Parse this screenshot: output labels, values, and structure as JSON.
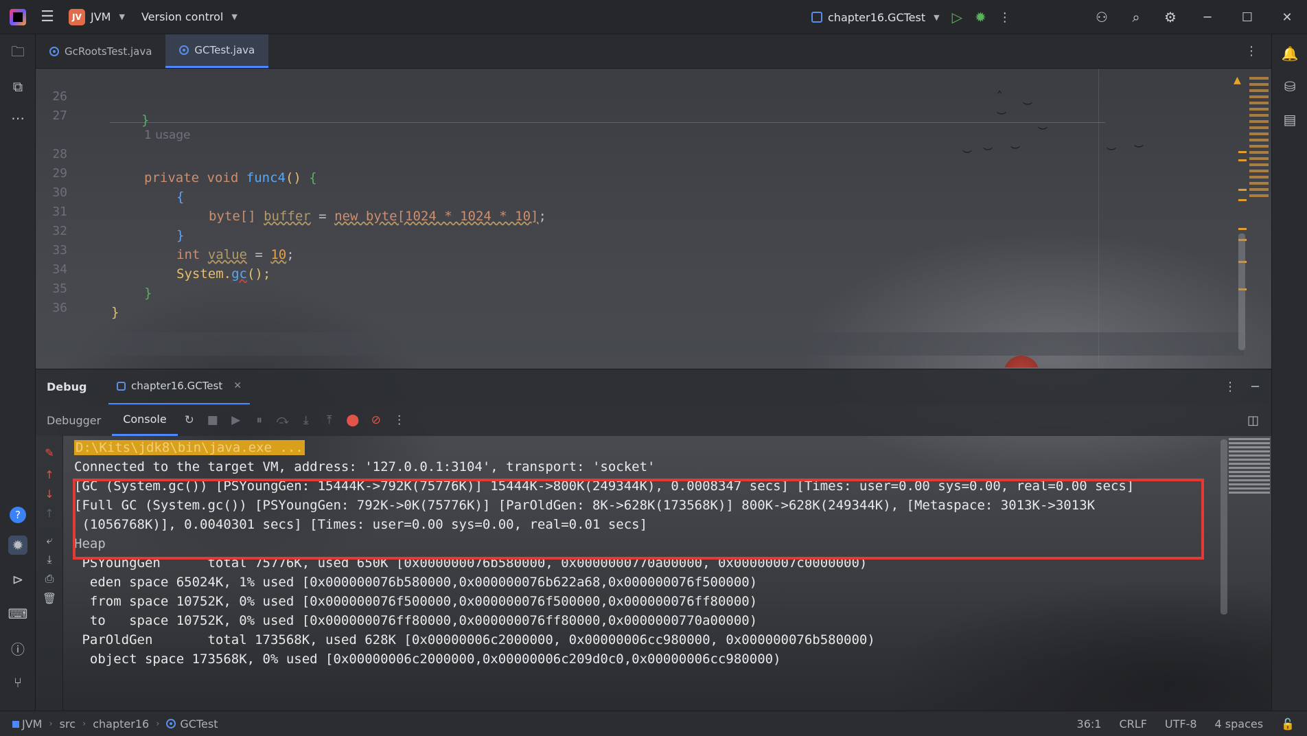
{
  "titlebar": {
    "project_badge": "JV",
    "project_name": "JVM",
    "vcs_label": "Version control",
    "run_config": "chapter16.GCTest"
  },
  "editor_tabs": [
    {
      "label": "GcRootsTest.java",
      "active": false
    },
    {
      "label": "GCTest.java",
      "active": true
    }
  ],
  "editor": {
    "lines": [
      {
        "num": "26",
        "code": "}"
      },
      {
        "num": "27",
        "code": ""
      },
      {
        "num": "",
        "hint": "1 usage"
      },
      {
        "num": "28",
        "code": "private void func4() {"
      },
      {
        "num": "29",
        "code": "{"
      },
      {
        "num": "30",
        "code": "byte[] buffer = new byte[1024 * 1024 * 10];"
      },
      {
        "num": "31",
        "code": "}"
      },
      {
        "num": "32",
        "code": "int value = 10;"
      },
      {
        "num": "33",
        "code": "System.gc();"
      },
      {
        "num": "34",
        "code": "}"
      },
      {
        "num": "35",
        "code": "}"
      },
      {
        "num": "36",
        "code": ""
      }
    ],
    "tokens": {
      "l28_kw1": "private",
      "l28_kw2": "void",
      "l28_fn": "func4",
      "l28_rest": "() ",
      "l28_brace": "{",
      "l30_type": "byte[]",
      "l30_var": "buffer",
      "l30_eq": " = ",
      "l30_new": "new byte[1024 * 1024 * 10]",
      "l30_end": ";",
      "l32_kw": "int",
      "l32_var": "value",
      "l32_eq": " = ",
      "l32_num": "10",
      "l32_end": ";",
      "l33_obj": "System.",
      "l33_fn": "gc",
      "l33_end": "();"
    }
  },
  "debug": {
    "title": "Debug",
    "session_tab": "chapter16.GCTest",
    "tabs": [
      "Debugger",
      "Console"
    ],
    "active_tab": "Console"
  },
  "console": {
    "lines": [
      "D:\\Kits\\jdk8\\bin\\java.exe ...",
      "Connected to the target VM, address: '127.0.0.1:3104', transport: 'socket'",
      "[GC (System.gc()) [PSYoungGen: 15444K->792K(75776K)] 15444K->800K(249344K), 0.0008347 secs] [Times: user=0.00 sys=0.00, real=0.00 secs]",
      "[Full GC (System.gc()) [PSYoungGen: 792K->0K(75776K)] [ParOldGen: 8K->628K(173568K)] 800K->628K(249344K), [Metaspace: 3013K->3013K",
      " (1056768K)], 0.0040301 secs] [Times: user=0.00 sys=0.00, real=0.01 secs]",
      "Heap",
      " PSYoungGen      total 75776K, used 650K [0x000000076b580000, 0x0000000770a00000, 0x00000007c0000000)",
      "  eden space 65024K, 1% used [0x000000076b580000,0x000000076b622a68,0x000000076f500000)",
      "  from space 10752K, 0% used [0x000000076f500000,0x000000076f500000,0x000000076ff80000)",
      "  to   space 10752K, 0% used [0x000000076ff80000,0x000000076ff80000,0x0000000770a00000)",
      " ParOldGen       total 173568K, used 628K [0x00000006c2000000, 0x00000006cc980000, 0x000000076b580000)",
      "  object space 173568K, 0% used [0x00000006c2000000,0x00000006c209d0c0,0x00000006cc980000)"
    ]
  },
  "statusbar": {
    "crumbs": [
      "JVM",
      "src",
      "chapter16",
      "GCTest"
    ],
    "position": "36:1",
    "line_sep": "CRLF",
    "encoding": "UTF-8",
    "indent": "4 spaces"
  },
  "colors": {
    "accent": "#4d88ff",
    "highlight_box": "#e53935",
    "run_green": "#59b35a",
    "warning": "#e3a52b"
  },
  "icons": {
    "app": "intellij-logo-icon",
    "menu": "hamburger-menu-icon",
    "run": "play-icon",
    "debug": "bug-icon",
    "search": "search-icon",
    "settings": "gear-icon",
    "profile": "add-user-icon"
  }
}
